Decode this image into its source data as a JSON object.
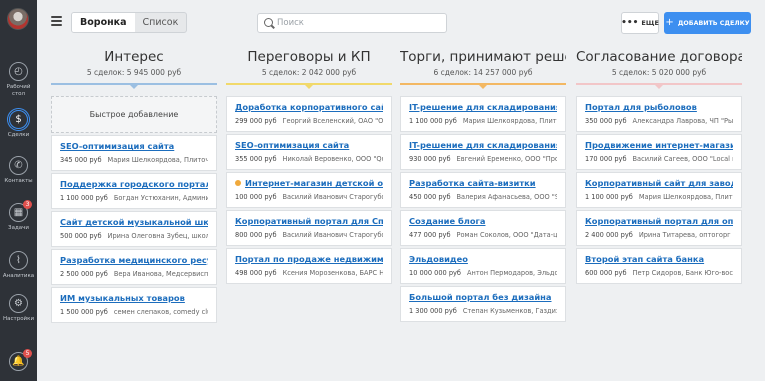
{
  "sidebar": {
    "items": [
      {
        "name": "dashboard",
        "label": "Рабочий стол",
        "icon": "speedometer-icon",
        "glyph": "◴",
        "badge": ""
      },
      {
        "name": "deals",
        "label": "Сделки",
        "icon": "dollar-icon",
        "glyph": "$",
        "badge": ""
      },
      {
        "name": "contacts",
        "label": "Контакты",
        "icon": "phone-icon",
        "glyph": "✆",
        "badge": ""
      },
      {
        "name": "tasks",
        "label": "Задачи",
        "icon": "calendar-icon",
        "glyph": "▦",
        "badge": "3"
      },
      {
        "name": "analytics",
        "label": "Аналитика",
        "icon": "chart-line-icon",
        "glyph": "⌇",
        "badge": ""
      },
      {
        "name": "settings",
        "label": "Настройки",
        "icon": "gear-icon",
        "glyph": "⚙",
        "badge": ""
      },
      {
        "name": "notifications",
        "label": "",
        "icon": "bell-icon",
        "glyph": "🔔",
        "badge": "5"
      }
    ],
    "active": "deals"
  },
  "topbar": {
    "view_tabs": [
      "Воронка",
      "Список"
    ],
    "active_view": "Воронка",
    "search_placeholder": "Поиск",
    "more_label": "ЕЩЕ",
    "add_label": "ДОБАВИТЬ СДЕЛКУ"
  },
  "colors": {
    "accent": "#3d8ff0",
    "column_bars": [
      "#9bbfe2",
      "#f1d96b",
      "#f3b863",
      "#f2c6c8"
    ]
  },
  "columns": [
    {
      "title": "Интерес",
      "summary": "5 сделок: 5 945 000 руб",
      "quick_add": "Быстрое добавление",
      "cards": [
        {
          "title": "SEO-оптимизация сайта",
          "price": "345 000 руб",
          "person": "Мария Шелкоярдова, Плиточ...",
          "dot": false
        },
        {
          "title": "Поддержка городского портала",
          "price": "1 100 000 руб",
          "person": "Богдан Устюханин, Администр...",
          "dot": false
        },
        {
          "title": "Сайт детской музыкальной школы",
          "price": "500 000 руб",
          "person": "Ирина Олеговна Зубец, школа22",
          "dot": false
        },
        {
          "title": "Разработка медицинского ресурса",
          "price": "2 500 000 руб",
          "person": "Вера Иванова, Медсервисплюс",
          "dot": false
        },
        {
          "title": "ИМ музыкальных товаров",
          "price": "1 500 000 руб",
          "person": "семен слепаков, comedy club",
          "dot": false
        }
      ]
    },
    {
      "title": "Переговоры и КП",
      "summary": "5 сделок: 2 042 000 руб",
      "quick_add": "",
      "cards": [
        {
          "title": "Доработка корпоративного сайта",
          "price": "299 000 руб",
          "person": "Георгий Вселенский, ОАО \"Орио...",
          "dot": false
        },
        {
          "title": "SEO-оптимизация сайта",
          "price": "355 000 руб",
          "person": "Николай Веровенко, ООО \"Quick...",
          "dot": false
        },
        {
          "title": "Интернет-магазин детской одежды",
          "price": "100 000 руб",
          "person": "Василий Иванович Старогубов, ...",
          "dot": true
        },
        {
          "title": "Корпоративный портал для Спец.монт...",
          "price": "800 000 руб",
          "person": "Василий Иванович Старогубов, ...",
          "dot": false
        },
        {
          "title": "Портал по продаже недвижимости",
          "price": "498 000 руб",
          "person": "Ксения Морозенкова, БАРС Недв...",
          "dot": false
        }
      ]
    },
    {
      "title": "Торги, принимают решение",
      "summary": "6 сделок: 14 257 000 руб",
      "quick_add": "",
      "cards": [
        {
          "title": "IT-решение для складирования",
          "price": "1 100 000 руб",
          "person": "Мария Шелкоярдова, Плиточ...",
          "dot": false
        },
        {
          "title": "IT-решение для складирования",
          "price": "930 000 руб",
          "person": "Евгений Еременко, ООО \"ПроП...",
          "dot": false
        },
        {
          "title": "Разработка сайта-визитки",
          "price": "450 000 руб",
          "person": "Валерия Афанасьева, ООО \"SergC...",
          "dot": false
        },
        {
          "title": "Создание блога",
          "price": "477 000 руб",
          "person": "Роман Соколов, ООО \"Дата-центр...",
          "dot": false
        },
        {
          "title": "Эльдовидео",
          "price": "10 000 000 руб",
          "person": "Антон Пермодаров, Эльдовидео",
          "dot": false
        },
        {
          "title": "Большой портал без дизайна",
          "price": "1 300 000 руб",
          "person": "Степан Кузьменков, Газдизайн...",
          "dot": false
        }
      ]
    },
    {
      "title": "Согласование договора",
      "summary": "5 сделок: 5 020 000 руб",
      "quick_add": "",
      "cards": [
        {
          "title": "Портал для рыболовов",
          "price": "350 000 руб",
          "person": "Александра Лаврова, ЧП \"Рыбн...",
          "dot": false
        },
        {
          "title": "Продвижение интернет-магазина",
          "price": "170 000 руб",
          "person": "Василий Сагеев, ООО \"Local med...",
          "dot": false
        },
        {
          "title": "Корпоративный сайт для завода пли...",
          "price": "1 100 000 руб",
          "person": "Мария Шелкоярдова, Плиточ...",
          "dot": false
        },
        {
          "title": "Корпоративный портал для оптовой ...",
          "price": "2 400 000 руб",
          "person": "Ирина Титарева, оптогорг",
          "dot": false
        },
        {
          "title": "Второй этап сайта банка",
          "price": "600 000 руб",
          "person": "Петр Сидоров, Банк Юго-восток",
          "dot": false
        }
      ]
    }
  ]
}
